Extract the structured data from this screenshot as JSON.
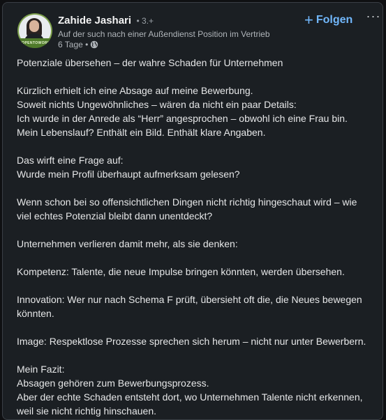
{
  "author": {
    "name": "Zahide Jashari",
    "degree": "• 3.+",
    "headline": "Auf der such nach einer Außendienst Position im Vertrieb",
    "time": "6 Tage •",
    "avatar_badge": "#OPENTOWORK"
  },
  "actions": {
    "follow_label": "Folgen",
    "follow_icon": "plus-icon",
    "more_label": "···"
  },
  "icons": {
    "visibility": "globe-icon"
  },
  "colors": {
    "background": "#1b1f23",
    "accent": "#71b7fb",
    "text": "#e6e7e8",
    "subtext": "#b0b5ba"
  },
  "post": {
    "lines": [
      "Potenziale übersehen – der wahre Schaden für Unternehmen",
      "",
      "Kürzlich erhielt ich eine Absage auf meine Bewerbung.",
      "Soweit nichts Ungewöhnliches – wären da nicht ein paar Details:",
      "Ich wurde in der Anrede als “Herr” angesprochen – obwohl ich eine Frau bin.",
      "Mein Lebenslauf? Enthält ein Bild. Enthält klare Angaben.",
      "",
      "Das wirft eine Frage auf:",
      "Wurde mein Profil überhaupt aufmerksam gelesen?",
      "",
      "Wenn schon bei so offensichtlichen Dingen nicht richtig hingeschaut wird – wie viel echtes Potenzial bleibt dann unentdeckt?",
      "",
      "Unternehmen verlieren damit mehr, als sie denken:",
      "",
      "Kompetenz: Talente, die neue Impulse bringen könnten, werden übersehen.",
      "",
      "Innovation: Wer nur nach Schema F prüft, übersieht oft die, die Neues bewegen könnten.",
      "",
      "Image: Respektlose Prozesse sprechen sich herum – nicht nur unter Bewerbern.",
      "",
      "Mein Fazit:",
      "Absagen gehören zum Bewerbungsprozess.",
      "Aber der echte Schaden entsteht dort, wo Unternehmen Talente nicht erkennen, weil sie nicht richtig hinschauen."
    ]
  }
}
